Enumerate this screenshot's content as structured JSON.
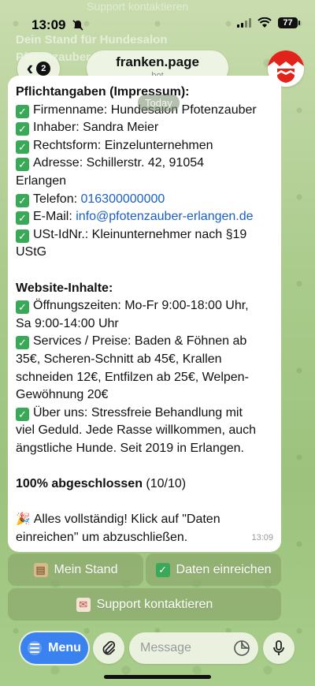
{
  "status": {
    "time": "13:09",
    "battery": "77"
  },
  "ghost": {
    "top": "Support kontaktieren",
    "line1": "Dein Stand für Hundesalon",
    "line2": "Pfotenzauber"
  },
  "header": {
    "back_count": "2",
    "title": "franken.page",
    "subtitle": "bot"
  },
  "date_badge": "Today",
  "message": {
    "section1_title": "Pflichtangaben (Impressum):",
    "firmenname": "Firmenname: Hundesalon Pfotenzauber",
    "inhaber": "Inhaber: Sandra Meier",
    "rechtsform": "Rechtsform: Einzelunternehmen",
    "adresse_1": "Adresse: Schillerstr. 42, 91054",
    "adresse_2": "Erlangen",
    "telefon_label": "Telefon: ",
    "telefon_value": "016300000000",
    "email_label": "E-Mail: ",
    "email_value": "info@pfotenzauber-erlangen.de",
    "ust_1": "USt-IdNr.: Kleinunternehmer nach §19",
    "ust_2": "UStG",
    "section2_title": "Website-Inhalte:",
    "oeffnung_1": "Öffnungszeiten: Mo-Fr 9:00-18:00 Uhr,",
    "oeffnung_2": "Sa 9:00-14:00 Uhr",
    "services_1": "Services / Preise: Baden & Föhnen ab",
    "services_2": "35€, Scheren-Schnitt ab 45€, Krallen",
    "services_3": "schneiden 12€, Entfilzen ab 25€, Welpen-",
    "services_4": "Gewöhnung 20€",
    "ueber_1": "Über uns: Stressfreie Behandlung mit",
    "ueber_2": "viel Geduld. Jede Rasse willkommen, auch",
    "ueber_3": "ängstliche Hunde. Seit 2019 in Erlangen.",
    "progress_bold": "100% abgeschlossen",
    "progress_count": " (10/10)",
    "final_1": "Alles vollständig! Klick auf \"Daten",
    "final_2": "einreichen\" um abzuschließen.",
    "time": "13:09"
  },
  "keyboard": {
    "mein_stand": "Mein Stand",
    "daten_einreichen": "Daten einreichen",
    "support": "Support kontaktieren"
  },
  "input_bar": {
    "menu_label": "Menu",
    "placeholder": "Message"
  },
  "colors": {
    "link": "#1a5ec8",
    "menu_button": "#3a82f0",
    "check": "#3aa957"
  }
}
